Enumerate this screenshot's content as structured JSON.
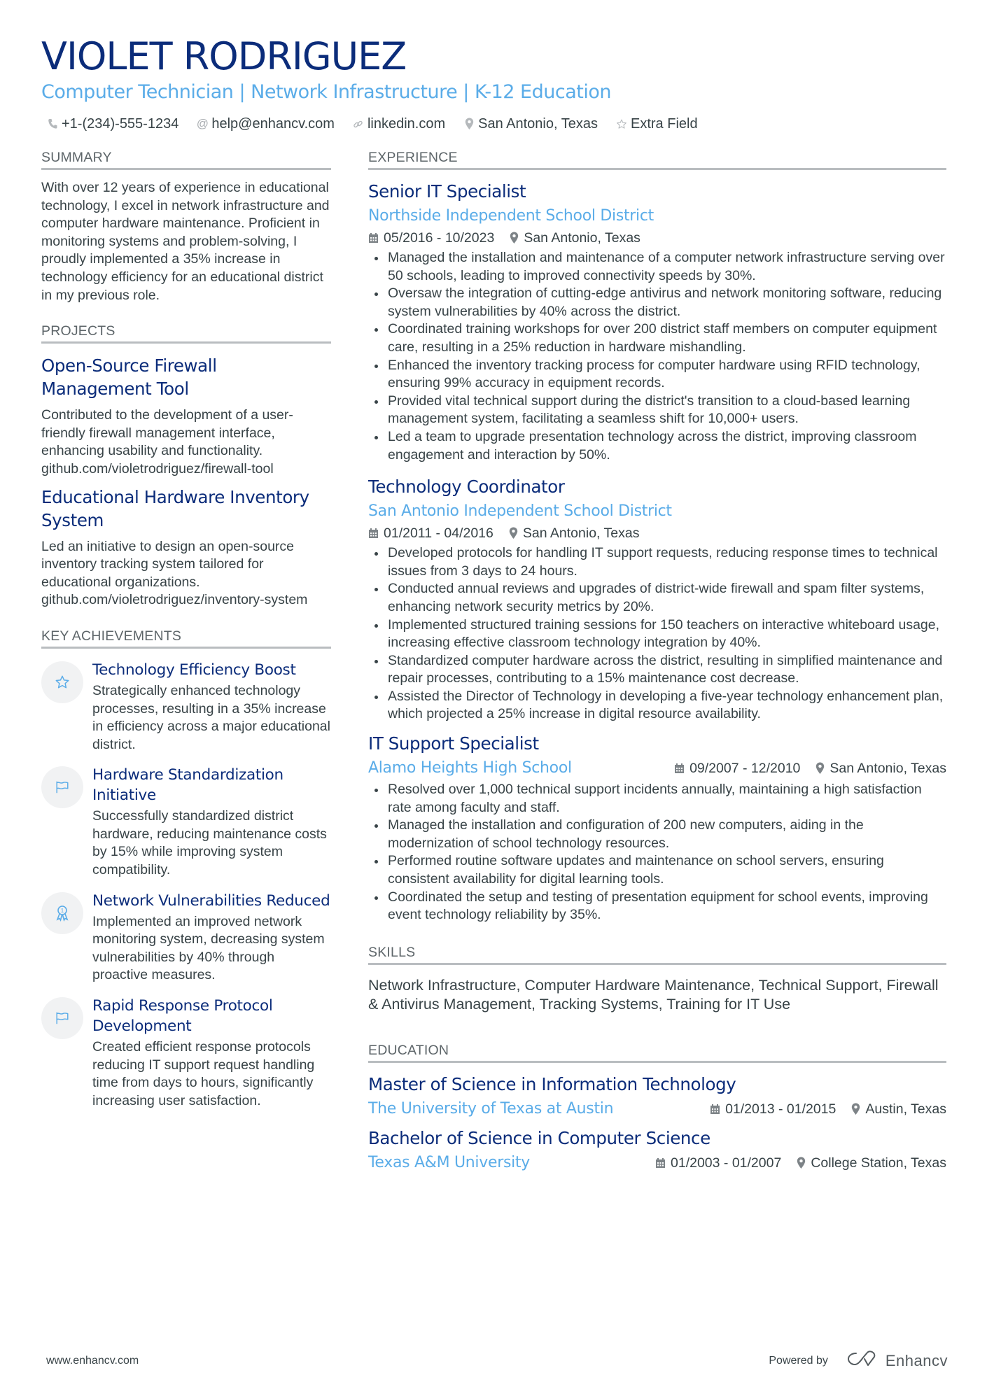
{
  "header": {
    "name": "VIOLET RODRIGUEZ",
    "headline": "Computer Technician | Network Infrastructure | K-12 Education",
    "contacts": [
      {
        "icon": "phone-icon",
        "text": "+1-(234)-555-1234"
      },
      {
        "icon": "at-icon",
        "text": "help@enhancv.com"
      },
      {
        "icon": "link-icon",
        "text": "linkedin.com"
      },
      {
        "icon": "location-pin-icon",
        "text": "San Antonio, Texas"
      },
      {
        "icon": "star-icon",
        "text": "Extra Field"
      }
    ]
  },
  "summary": {
    "title": "SUMMARY",
    "text": "With over 12 years of experience in educational technology, I excel in network infrastructure and computer hardware maintenance. Proficient in monitoring systems and problem-solving, I proudly implemented a 35% increase in technology efficiency for an educational district in my previous role."
  },
  "projects": {
    "title": "PROJECTS",
    "items": [
      {
        "title": "Open-Source Firewall Management Tool",
        "description": "Contributed to the development of a user-friendly firewall management interface, enhancing usability and functionality.",
        "link": "github.com/violetrodriguez/firewall-tool"
      },
      {
        "title": "Educational Hardware Inventory System",
        "description": "Led an initiative to design an open-source inventory tracking system tailored for educational organizations.",
        "link": "github.com/violetrodriguez/inventory-system"
      }
    ]
  },
  "achievements": {
    "title": "KEY ACHIEVEMENTS",
    "items": [
      {
        "icon": "star-icon",
        "title": "Technology Efficiency Boost",
        "description": "Strategically enhanced technology processes, resulting in a 35% increase in efficiency across a major educational district."
      },
      {
        "icon": "flag-icon",
        "title": "Hardware Standardization Initiative",
        "description": "Successfully standardized district hardware, reducing maintenance costs by 15% while improving system compatibility."
      },
      {
        "icon": "award-ribbon-icon",
        "title": "Network Vulnerabilities Reduced",
        "description": "Implemented an improved network monitoring system, decreasing system vulnerabilities by 40% through proactive measures."
      },
      {
        "icon": "flag-icon",
        "title": "Rapid Response Protocol Development",
        "description": "Created efficient response protocols reducing IT support request handling time from days to hours, significantly increasing user satisfaction."
      }
    ]
  },
  "experience": {
    "title": "EXPERIENCE",
    "jobs": [
      {
        "title": "Senior IT Specialist",
        "company": "Northside Independent School District",
        "dates": "05/2016 - 10/2023",
        "location": "San Antonio, Texas",
        "bullets": [
          "Managed the installation and maintenance of a computer network infrastructure serving over 50 schools, leading to improved connectivity speeds by 30%.",
          "Oversaw the integration of cutting-edge antivirus and network monitoring software, reducing system vulnerabilities by 40% across the district.",
          "Coordinated training workshops for over 200 district staff members on computer equipment care, resulting in a 25% reduction in hardware mishandling.",
          "Enhanced the inventory tracking process for computer hardware using RFID technology, ensuring 99% accuracy in equipment records.",
          "Provided vital technical support during the district's transition to a cloud-based learning management system, facilitating a seamless shift for 10,000+ users.",
          "Led a team to upgrade presentation technology across the district, improving classroom engagement and interaction by 50%."
        ]
      },
      {
        "title": "Technology Coordinator",
        "company": "San Antonio Independent School District",
        "dates": "01/2011 - 04/2016",
        "location": "San Antonio, Texas",
        "bullets": [
          "Developed protocols for handling IT support requests, reducing response times to technical issues from 3 days to 24 hours.",
          "Conducted annual reviews and upgrades of district-wide firewall and spam filter systems, enhancing network security metrics by 20%.",
          "Implemented structured training sessions for 150 teachers on interactive whiteboard usage, increasing effective classroom technology integration by 40%.",
          "Standardized computer hardware across the district, resulting in simplified maintenance and repair processes, contributing to a 15% maintenance cost decrease.",
          "Assisted the Director of Technology in developing a five-year technology enhancement plan, which projected a 25% increase in digital resource availability."
        ]
      },
      {
        "title": "IT Support Specialist",
        "company": "Alamo Heights High School",
        "dates": "09/2007 - 12/2010",
        "location": "San Antonio, Texas",
        "bullets": [
          "Resolved over 1,000 technical support incidents annually, maintaining a high satisfaction rate among faculty and staff.",
          "Managed the installation and configuration of 200 new computers, aiding in the modernization of school technology resources.",
          "Performed routine software updates and maintenance on school servers, ensuring consistent availability for digital learning tools.",
          "Coordinated the setup and testing of presentation equipment for school events, improving event technology reliability by 35%."
        ]
      }
    ]
  },
  "skills": {
    "title": "SKILLS",
    "text": "Network Infrastructure, Computer Hardware Maintenance, Technical Support, Firewall & Antivirus Management, Tracking Systems, Training for IT Use"
  },
  "education": {
    "title": "EDUCATION",
    "items": [
      {
        "degree": "Master of Science in Information Technology",
        "school": "The University of Texas at Austin",
        "dates": "01/2013 - 01/2015",
        "location": "Austin, Texas"
      },
      {
        "degree": "Bachelor of Science in Computer Science",
        "school": "Texas A&M University",
        "dates": "01/2003 - 01/2007",
        "location": "College Station, Texas"
      }
    ]
  },
  "footer": {
    "website": "www.enhancv.com",
    "powered_by": "Powered by",
    "brand": "Enhancv"
  },
  "colors": {
    "name": "#0b2c7a",
    "accent": "#5aace8",
    "text": "#384347",
    "rule": "#b9bdc0"
  }
}
